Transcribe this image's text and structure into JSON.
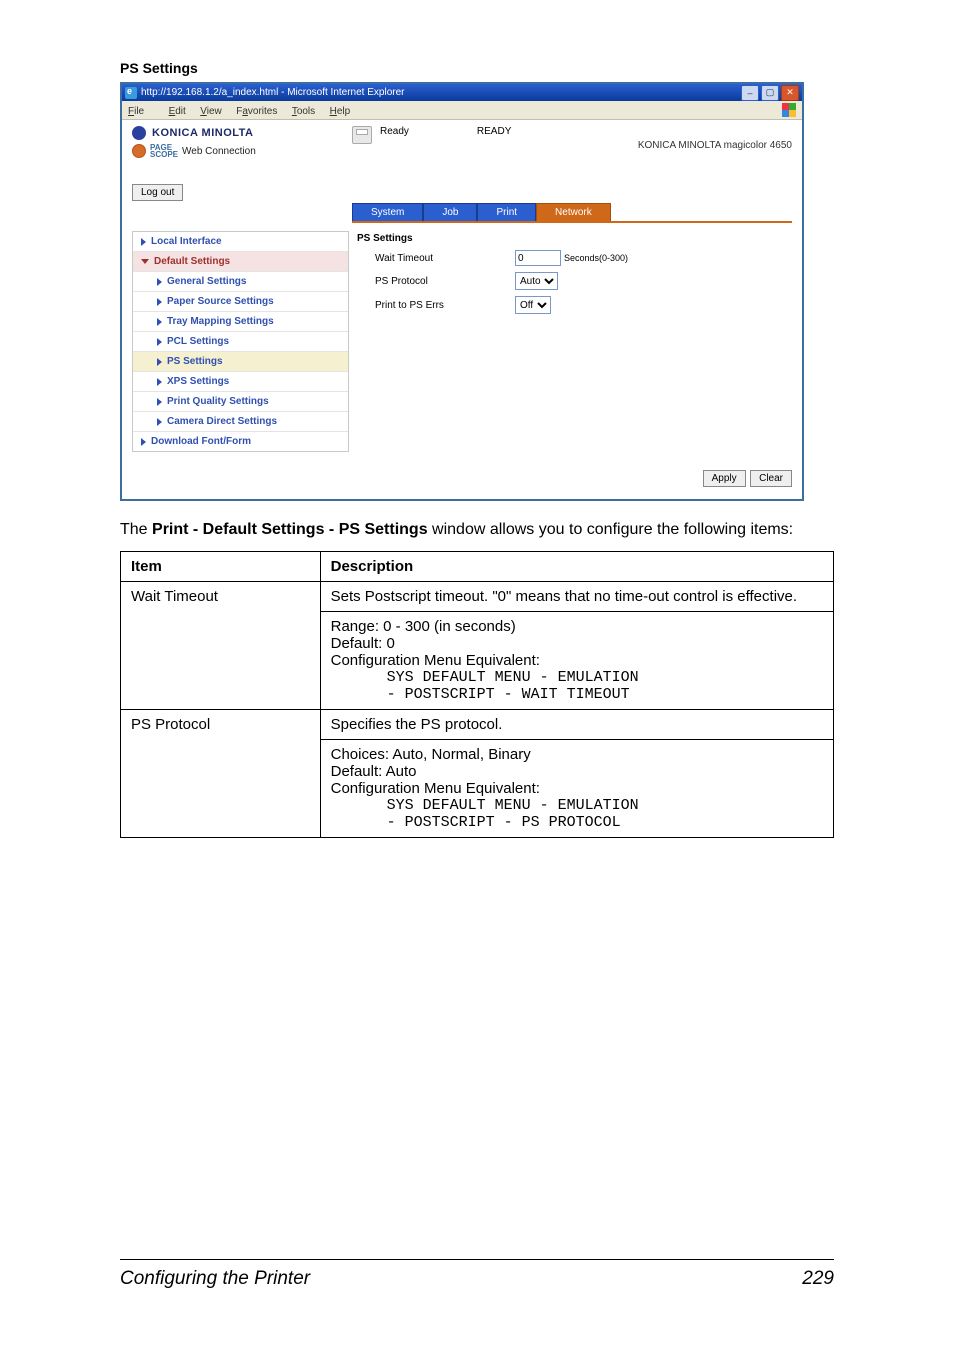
{
  "section_heading": "PS Settings",
  "ie": {
    "title": "http://192.168.1.2/a_index.html - Microsoft Internet Explorer",
    "menu": {
      "file": "File",
      "edit": "Edit",
      "view": "View",
      "favorites": "Favorites",
      "tools": "Tools",
      "help": "Help"
    },
    "brand": "KONICA MINOLTA",
    "pagescope_label": "PAGE\nSCOPE",
    "pagescope_text": "Web Connection",
    "status_label": "Ready",
    "ready_label": "READY",
    "model": "KONICA MINOLTA magicolor 4650",
    "logout": "Log out",
    "tabs": {
      "system": "System",
      "job": "Job",
      "print": "Print",
      "network": "Network"
    },
    "sidebar": {
      "local_if": "Local Interface",
      "default_settings": "Default Settings",
      "general": "General Settings",
      "paper_source": "Paper Source Settings",
      "tray_mapping": "Tray Mapping Settings",
      "pcl": "PCL Settings",
      "ps": "PS Settings",
      "xps": "XPS Settings",
      "print_quality": "Print Quality Settings",
      "camera": "Camera Direct Settings",
      "download": "Download Font/Form"
    },
    "content": {
      "heading": "PS Settings",
      "wait_timeout": "Wait Timeout",
      "wait_value": "0",
      "wait_hint": "Seconds(0-300)",
      "ps_protocol": "PS Protocol",
      "protocol_value": "Auto",
      "print_ps_errs": "Print to PS Errs",
      "errs_value": "Off"
    },
    "buttons": {
      "apply": "Apply",
      "clear": "Clear"
    }
  },
  "para": {
    "pre": "The ",
    "bold": "Print - Default Settings - PS Settings",
    "post": " window allows you to configure the following items:"
  },
  "table": {
    "h1": "Item",
    "h2": "Description",
    "r1c1": "Wait Timeout",
    "r1a": "Sets Postscript timeout. \"0\" means that no time-out control is effective.",
    "r1b_line1": "Range:   0 - 300 (in seconds)",
    "r1b_line2": "Default:  0",
    "r1b_line3": "Configuration Menu Equivalent:",
    "r1b_code1": "SYS DEFAULT MENU - EMULATION",
    "r1b_code2": "- POSTSCRIPT - WAIT TIMEOUT",
    "r2c1": "PS Protocol",
    "r2a": "Specifies the PS protocol.",
    "r2b_line1": "Choices: Auto, Normal, Binary",
    "r2b_line2": "Default:  Auto",
    "r2b_line3": "Configuration Menu Equivalent:",
    "r2b_code1": "SYS DEFAULT MENU - EMULATION",
    "r2b_code2": "- POSTSCRIPT - PS PROTOCOL"
  },
  "footer": {
    "left": "Configuring the Printer",
    "right": "229"
  }
}
